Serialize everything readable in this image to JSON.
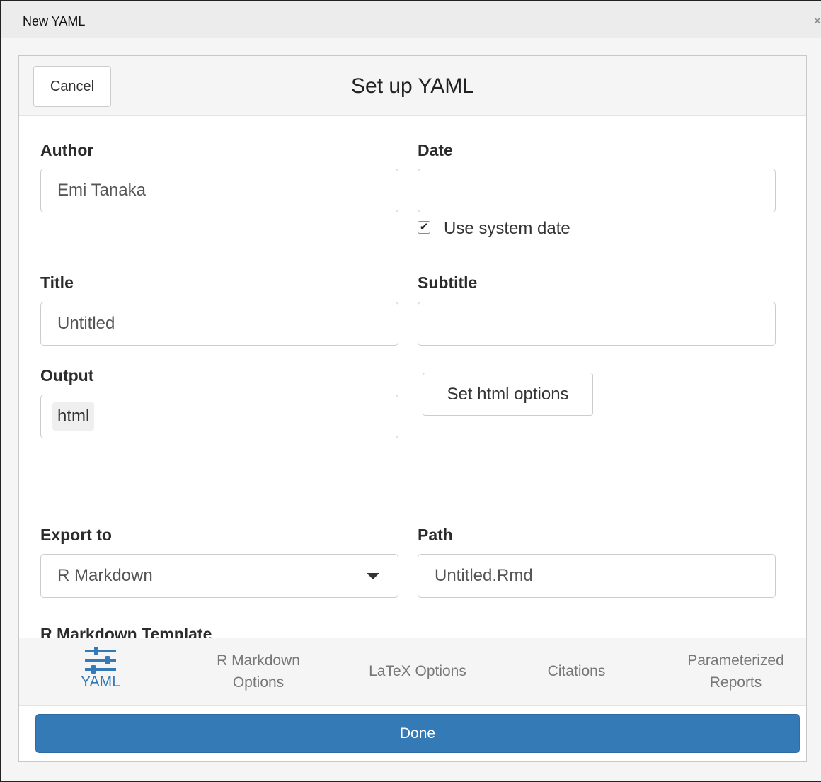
{
  "window": {
    "title": "New YAML",
    "close_glyph": "×"
  },
  "header": {
    "cancel_label": "Cancel",
    "title": "Set up YAML"
  },
  "form": {
    "author": {
      "label": "Author",
      "value": "Emi Tanaka"
    },
    "date": {
      "label": "Date",
      "value": "",
      "use_system_date_label": "Use system date",
      "use_system_date_checked": true,
      "check_glyph": "✔"
    },
    "title": {
      "label": "Title",
      "value": "Untitled"
    },
    "subtitle": {
      "label": "Subtitle",
      "value": ""
    },
    "output": {
      "label": "Output",
      "selected": "html",
      "options_button": "Set html options"
    },
    "export_to": {
      "label": "Export to",
      "selected": "R Markdown"
    },
    "path": {
      "label": "Path",
      "value": "Untitled.Rmd"
    },
    "template_label": "R Markdown Template"
  },
  "tabs": [
    {
      "line1": "YAML",
      "line2": "",
      "active": true,
      "icon": "sliders-icon"
    },
    {
      "line1": "R Markdown",
      "line2": "Options",
      "active": false
    },
    {
      "line1": "LaTeX Options",
      "line2": "",
      "active": false
    },
    {
      "line1": "Citations",
      "line2": "",
      "active": false
    },
    {
      "line1": "Parameterized",
      "line2": "Reports",
      "active": false
    }
  ],
  "footer": {
    "done_label": "Done"
  },
  "colors": {
    "accent": "#337ab7",
    "header_bg": "#f5f5f5",
    "border": "#cccccc"
  }
}
